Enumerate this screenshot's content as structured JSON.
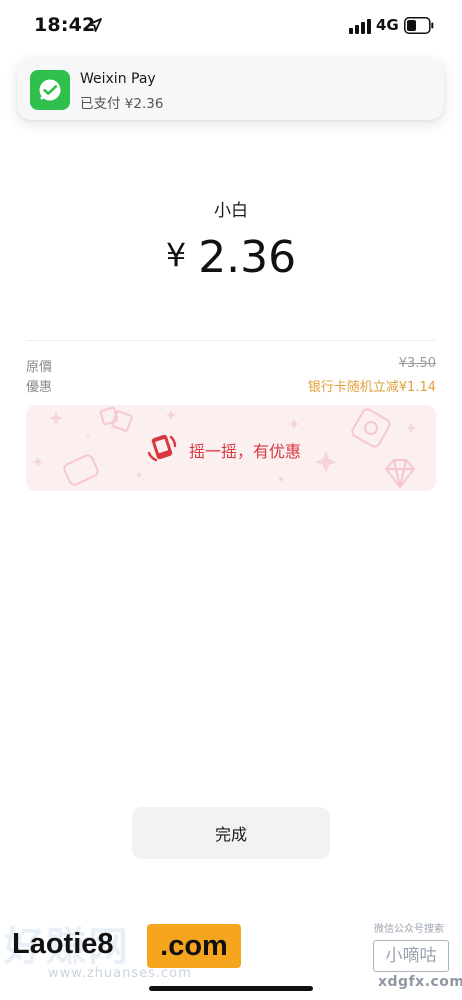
{
  "status_bar": {
    "time": "18:42",
    "network": "4G",
    "icons": [
      "location-arrow-icon",
      "signal-icon",
      "battery-icon"
    ]
  },
  "notification": {
    "app_name": "Weixin Pay",
    "message": "已支付 ¥2.36",
    "icon": "wechat-pay-icon",
    "accent_color": "#2fbf4d"
  },
  "payment": {
    "payee": "小白",
    "currency_symbol": "¥",
    "amount": "2.36"
  },
  "details": {
    "original_price_label": "原價",
    "original_price_value": "¥3.50",
    "discount_label": "優惠",
    "discount_value": "银行卡随机立减¥1.14",
    "discount_color": "#e0a13c"
  },
  "banner": {
    "label": "摇一摇，有优惠",
    "icon": "shake-icon",
    "text_color": "#d9383e"
  },
  "actions": {
    "done_label": "完成"
  },
  "watermarks": {
    "left_bg": "好赚网",
    "left_url": "www.zhuanses.com",
    "laotie": "Laotie8",
    "com": ".com",
    "right_top": "微信公众号搜索",
    "right_box": "小嘀咕",
    "right_url": "xdgfx.com"
  }
}
